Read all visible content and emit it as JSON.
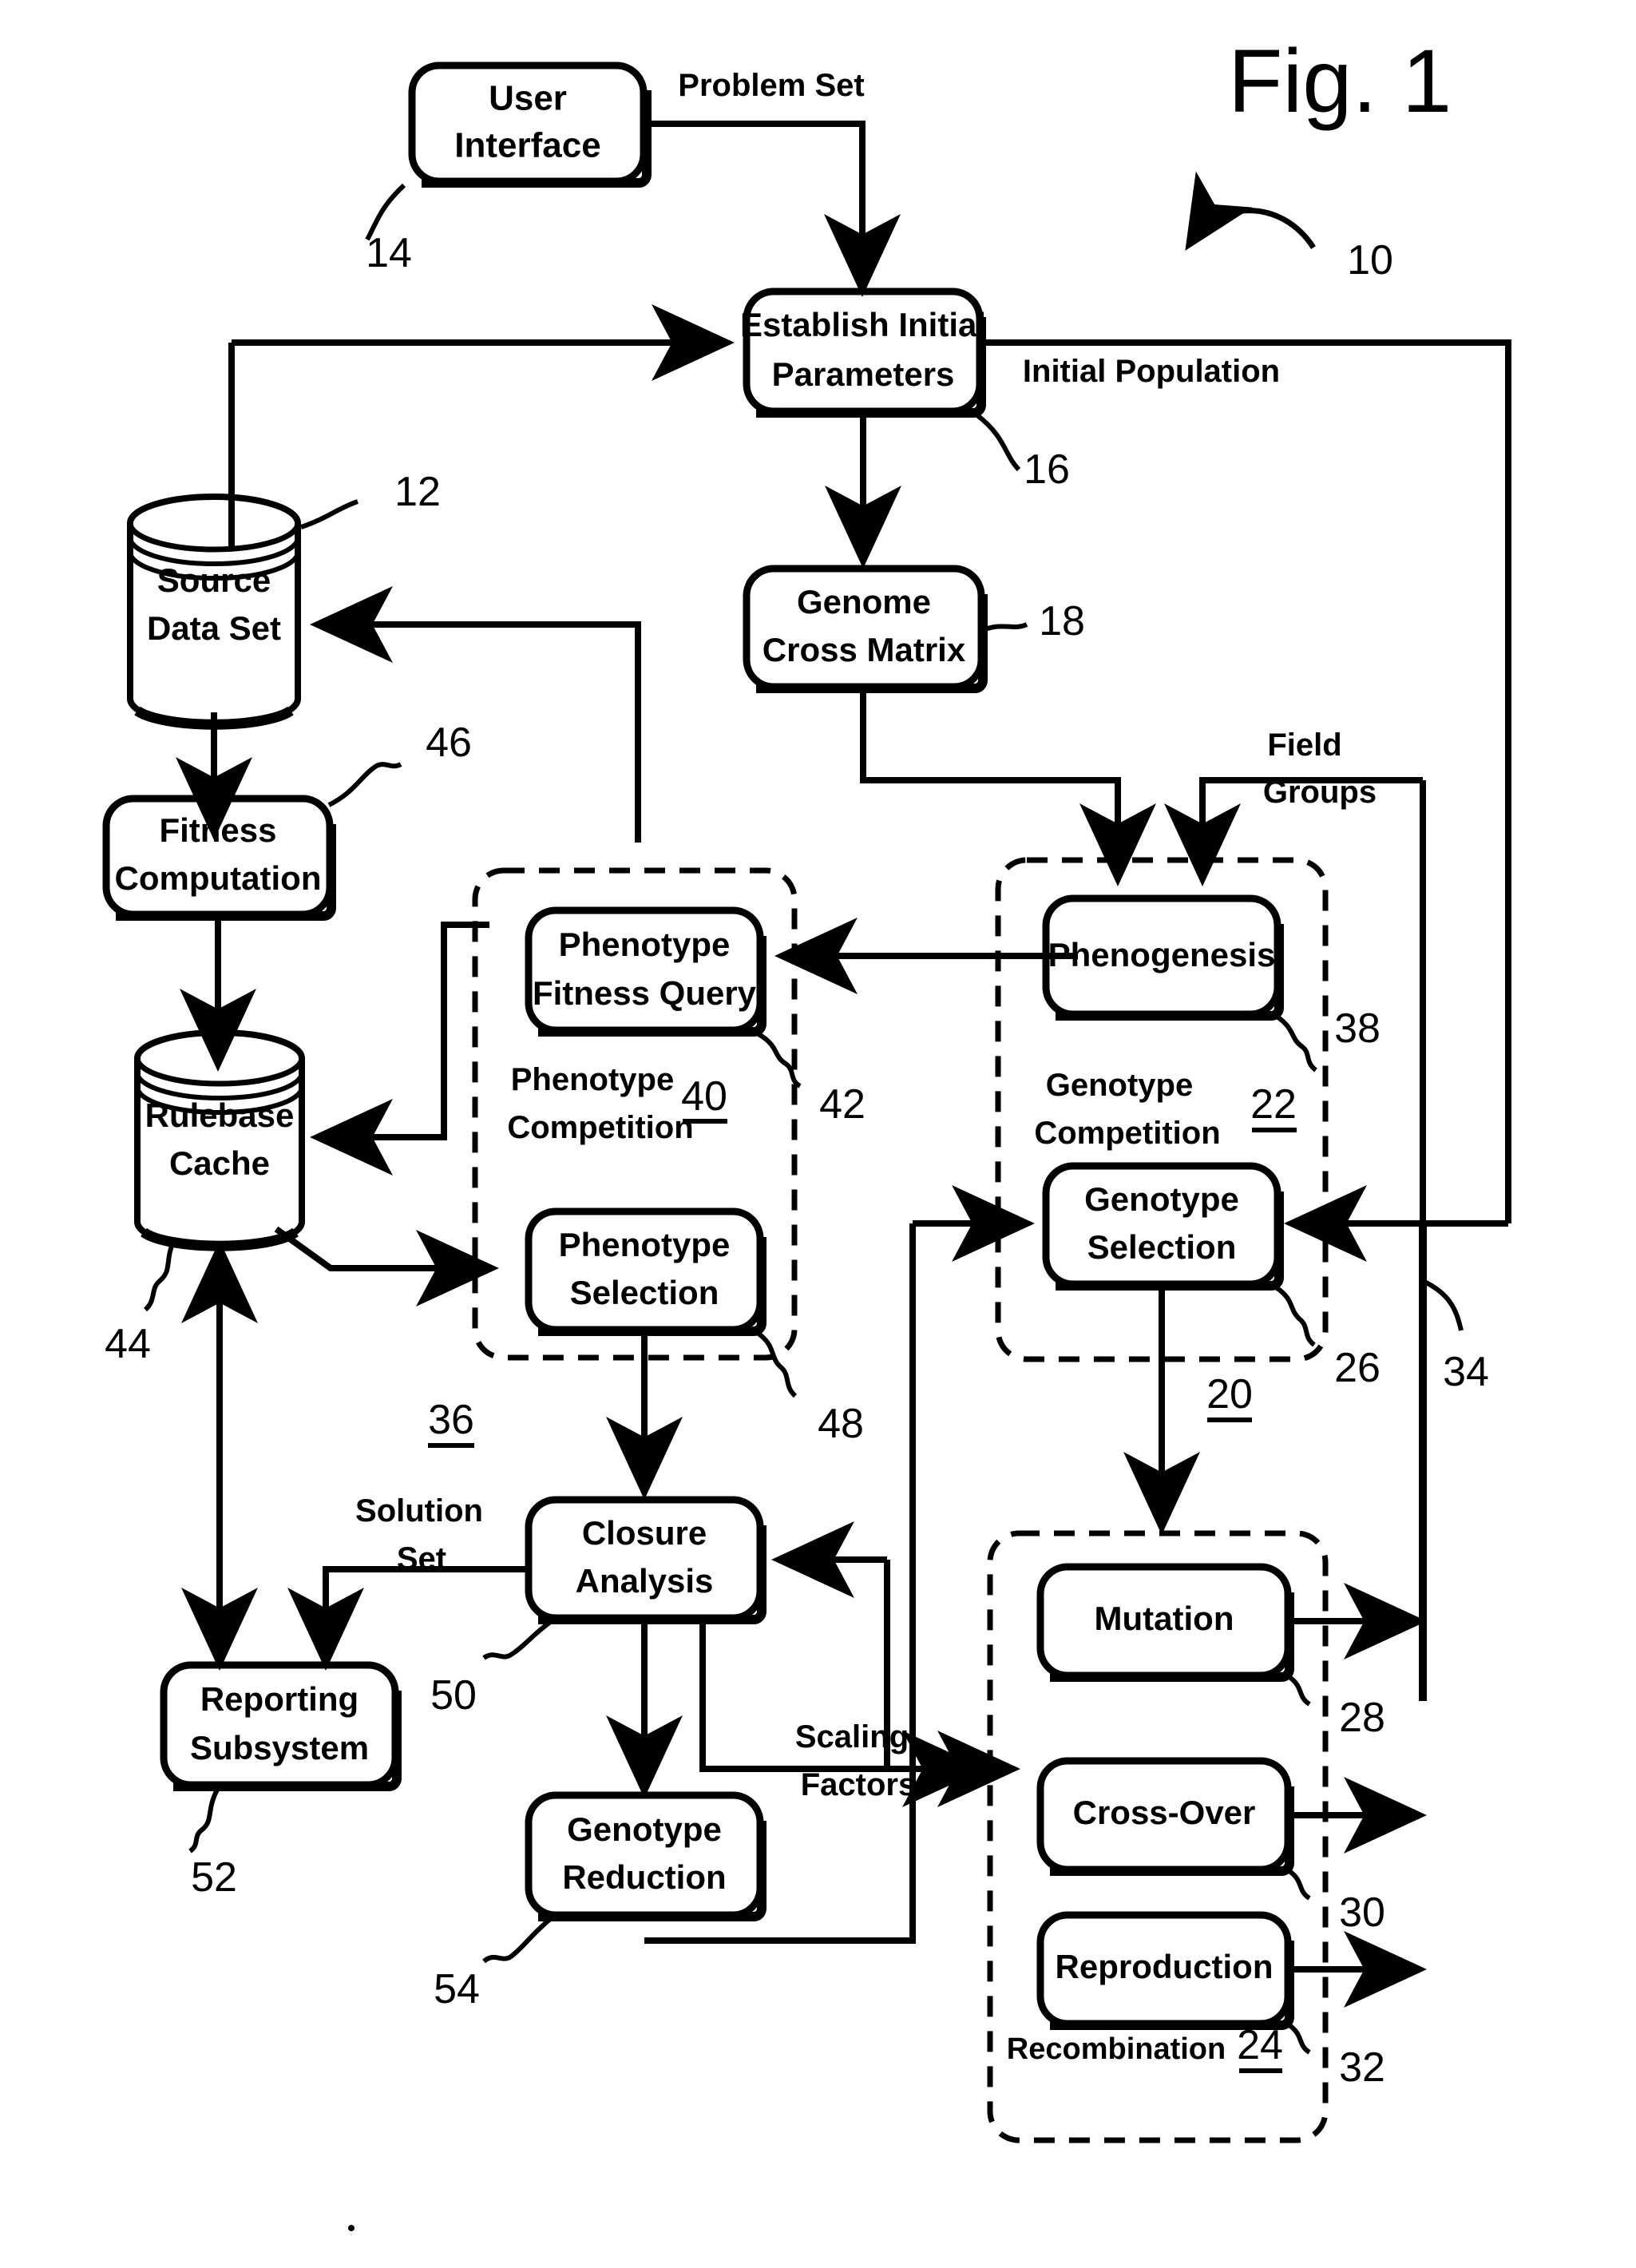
{
  "figure": {
    "title": "Fig. 1",
    "system_ref": "10"
  },
  "nodes": [
    {
      "id": "user-interface",
      "label_lines": [
        "User",
        "Interface"
      ],
      "ref": "14",
      "shape": "rounded-rect"
    },
    {
      "id": "establish-initial-parameters",
      "label_lines": [
        "Establish Initial",
        "Parameters"
      ],
      "ref": "16",
      "shape": "rounded-rect"
    },
    {
      "id": "source-data-set",
      "label_lines": [
        "Source",
        "Data Set"
      ],
      "ref": "12",
      "shape": "cylinder"
    },
    {
      "id": "genome-cross-matrix",
      "label_lines": [
        "Genome",
        "Cross Matrix"
      ],
      "ref": "18",
      "shape": "rounded-rect"
    },
    {
      "id": "fitness-computation",
      "label_lines": [
        "Fitness",
        "Computation"
      ],
      "ref": "46",
      "shape": "rounded-rect"
    },
    {
      "id": "rulebase-cache",
      "label_lines": [
        "Rulebase",
        "Cache"
      ],
      "ref": "44",
      "shape": "cylinder"
    },
    {
      "id": "phenotype-fitness-query",
      "label_lines": [
        "Phenotype",
        "Fitness Query"
      ],
      "ref": "42",
      "shape": "rounded-rect"
    },
    {
      "id": "phenotype-selection",
      "label_lines": [
        "Phenotype",
        "Selection"
      ],
      "ref": "48",
      "shape": "rounded-rect"
    },
    {
      "id": "phenogenesis",
      "label_lines": [
        "Phenogenesis"
      ],
      "ref": "38",
      "shape": "rounded-rect"
    },
    {
      "id": "genotype-selection",
      "label_lines": [
        "Genotype",
        "Selection"
      ],
      "ref": "26",
      "shape": "rounded-rect"
    },
    {
      "id": "closure-analysis",
      "label_lines": [
        "Closure",
        "Analysis"
      ],
      "ref": "50",
      "shape": "rounded-rect"
    },
    {
      "id": "reporting-subsystem",
      "label_lines": [
        "Reporting",
        "Subsystem"
      ],
      "ref": "52",
      "shape": "rounded-rect"
    },
    {
      "id": "genotype-reduction",
      "label_lines": [
        "Genotype",
        "Reduction"
      ],
      "ref": "54",
      "shape": "rounded-rect"
    },
    {
      "id": "mutation",
      "label_lines": [
        "Mutation"
      ],
      "ref": "28",
      "shape": "rounded-rect"
    },
    {
      "id": "cross-over",
      "label_lines": [
        "Cross-Over"
      ],
      "ref": "30",
      "shape": "rounded-rect"
    },
    {
      "id": "reproduction",
      "label_lines": [
        "Reproduction"
      ],
      "ref": "32",
      "shape": "rounded-rect"
    }
  ],
  "groups": [
    {
      "id": "phenotype-competition",
      "label_lines": [
        "Phenotype",
        "Competition"
      ],
      "ref": "40",
      "outer_ref": "36"
    },
    {
      "id": "genotype-competition",
      "label_lines": [
        "Genotype",
        "Competition"
      ],
      "ref": "22",
      "outer_ref": "20"
    },
    {
      "id": "recombination",
      "label_lines": [
        "Recombination"
      ],
      "ref": "24",
      "outer_ref": "34"
    }
  ],
  "edge_labels": [
    {
      "id": "problem-set",
      "text": "Problem Set"
    },
    {
      "id": "initial-population",
      "text": "Initial Population"
    },
    {
      "id": "field-groups",
      "lines": [
        "Field",
        "Groups"
      ]
    },
    {
      "id": "solution-set",
      "lines": [
        "Solution",
        "Set"
      ]
    },
    {
      "id": "scaling-factors",
      "lines": [
        "Scaling",
        "Factors"
      ]
    }
  ],
  "labels": {
    "user_interface": "User Interface",
    "user_interface_l1": "User",
    "user_interface_l2": "Interface",
    "establish_l1": "Establish Initial",
    "establish_l2": "Parameters",
    "source_l1": "Source",
    "source_l2": "Data Set",
    "genome_l1": "Genome",
    "genome_l2": "Cross Matrix",
    "fitness_l1": "Fitness",
    "fitness_l2": "Computation",
    "rulebase_l1": "Rulebase",
    "rulebase_l2": "Cache",
    "pfq_l1": "Phenotype",
    "pfq_l2": "Fitness Query",
    "psel_l1": "Phenotype",
    "psel_l2": "Selection",
    "phenogenesis": "Phenogenesis",
    "gsel_l1": "Genotype",
    "gsel_l2": "Selection",
    "closure_l1": "Closure",
    "closure_l2": "Analysis",
    "report_l1": "Reporting",
    "report_l2": "Subsystem",
    "greduce_l1": "Genotype",
    "greduce_l2": "Reduction",
    "mutation": "Mutation",
    "crossover": "Cross-Over",
    "reproduction": "Reproduction",
    "pcomp_l1": "Phenotype",
    "pcomp_l2": "Competition",
    "gcomp_l1": "Genotype",
    "gcomp_l2": "Competition",
    "recomb": "Recombination",
    "problem_set": "Problem Set",
    "initial_population": "Initial Population",
    "field_l1": "Field",
    "field_l2": "Groups",
    "solution_l1": "Solution",
    "solution_l2": "Set",
    "scaling_l1": "Scaling",
    "scaling_l2": "Factors",
    "fig_title": "Fig. 1"
  },
  "refs": {
    "r10": "10",
    "r12": "12",
    "r14": "14",
    "r16": "16",
    "r18": "18",
    "r20": "20",
    "r22": "22",
    "r24": "24",
    "r26": "26",
    "r28": "28",
    "r30": "30",
    "r32": "32",
    "r34": "34",
    "r36": "36",
    "r38": "38",
    "r40": "40",
    "r42": "42",
    "r44": "44",
    "r46": "46",
    "r48": "48",
    "r50": "50",
    "r52": "52",
    "r54": "54"
  },
  "colors": {
    "ink": "#000000",
    "paper": "#ffffff"
  }
}
